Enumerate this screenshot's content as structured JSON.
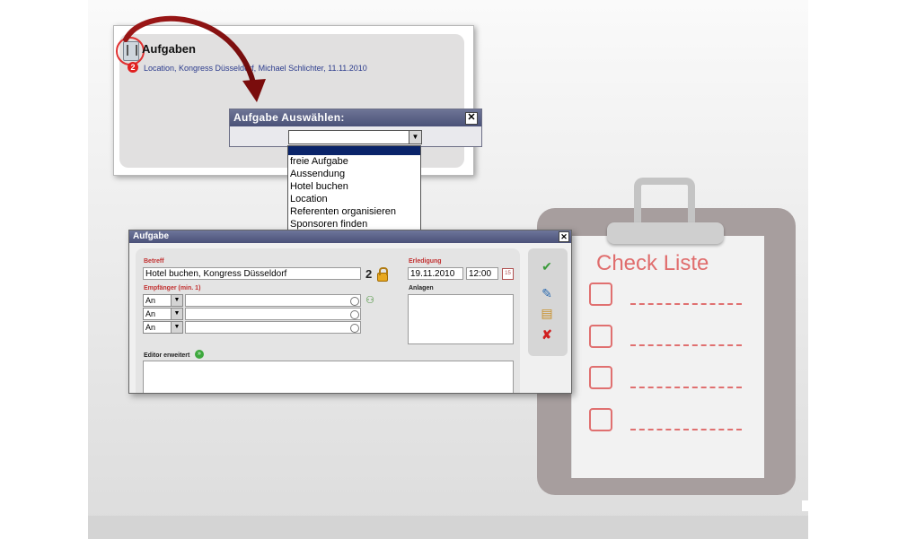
{
  "top_panel": {
    "title": "Aufgaben",
    "subtitle": "Location, Kongress Düsseldorf, Michael Schlichter, 11.11.2010",
    "badge": "2"
  },
  "select_dialog": {
    "title": "Aufgabe Auswählen:",
    "close": "✕",
    "arrow": "▼",
    "options": [
      "freie Aufgabe",
      "Aussendung",
      "Hotel buchen",
      "Location",
      "Referenten organisieren",
      "Sponsoren finden"
    ]
  },
  "task_window": {
    "title": "Aufgabe",
    "close": "✕",
    "betreff_label": "Betreff",
    "betreff_value": "Hotel buchen, Kongress Düsseldorf",
    "count": "2",
    "empfaenger_label": "Empfänger (min. 1)",
    "recipient_rows": [
      {
        "type": "An"
      },
      {
        "type": "An"
      },
      {
        "type": "An"
      }
    ],
    "erledigung_label": "Erledigung",
    "date": "19.11.2010",
    "time": "12:00",
    "cal_icon_text": "15",
    "anlagen_label": "Anlagen",
    "editor_label": "Editor erweitert",
    "editor_icon_text": "»"
  },
  "clipboard": {
    "title": "Check Liste",
    "items": 4
  },
  "colors": {
    "accent_red": "#e06d6d",
    "titlebar": "#4b5179",
    "link_blue": "#2a3a8c"
  },
  "icons": [
    "task-icon",
    "close-icon",
    "chevron-down-icon",
    "lock-icon",
    "calendar-icon",
    "contacts-icon",
    "save-check-icon",
    "edit-icon",
    "folder-icon",
    "delete-x-icon",
    "arrow-icon"
  ]
}
